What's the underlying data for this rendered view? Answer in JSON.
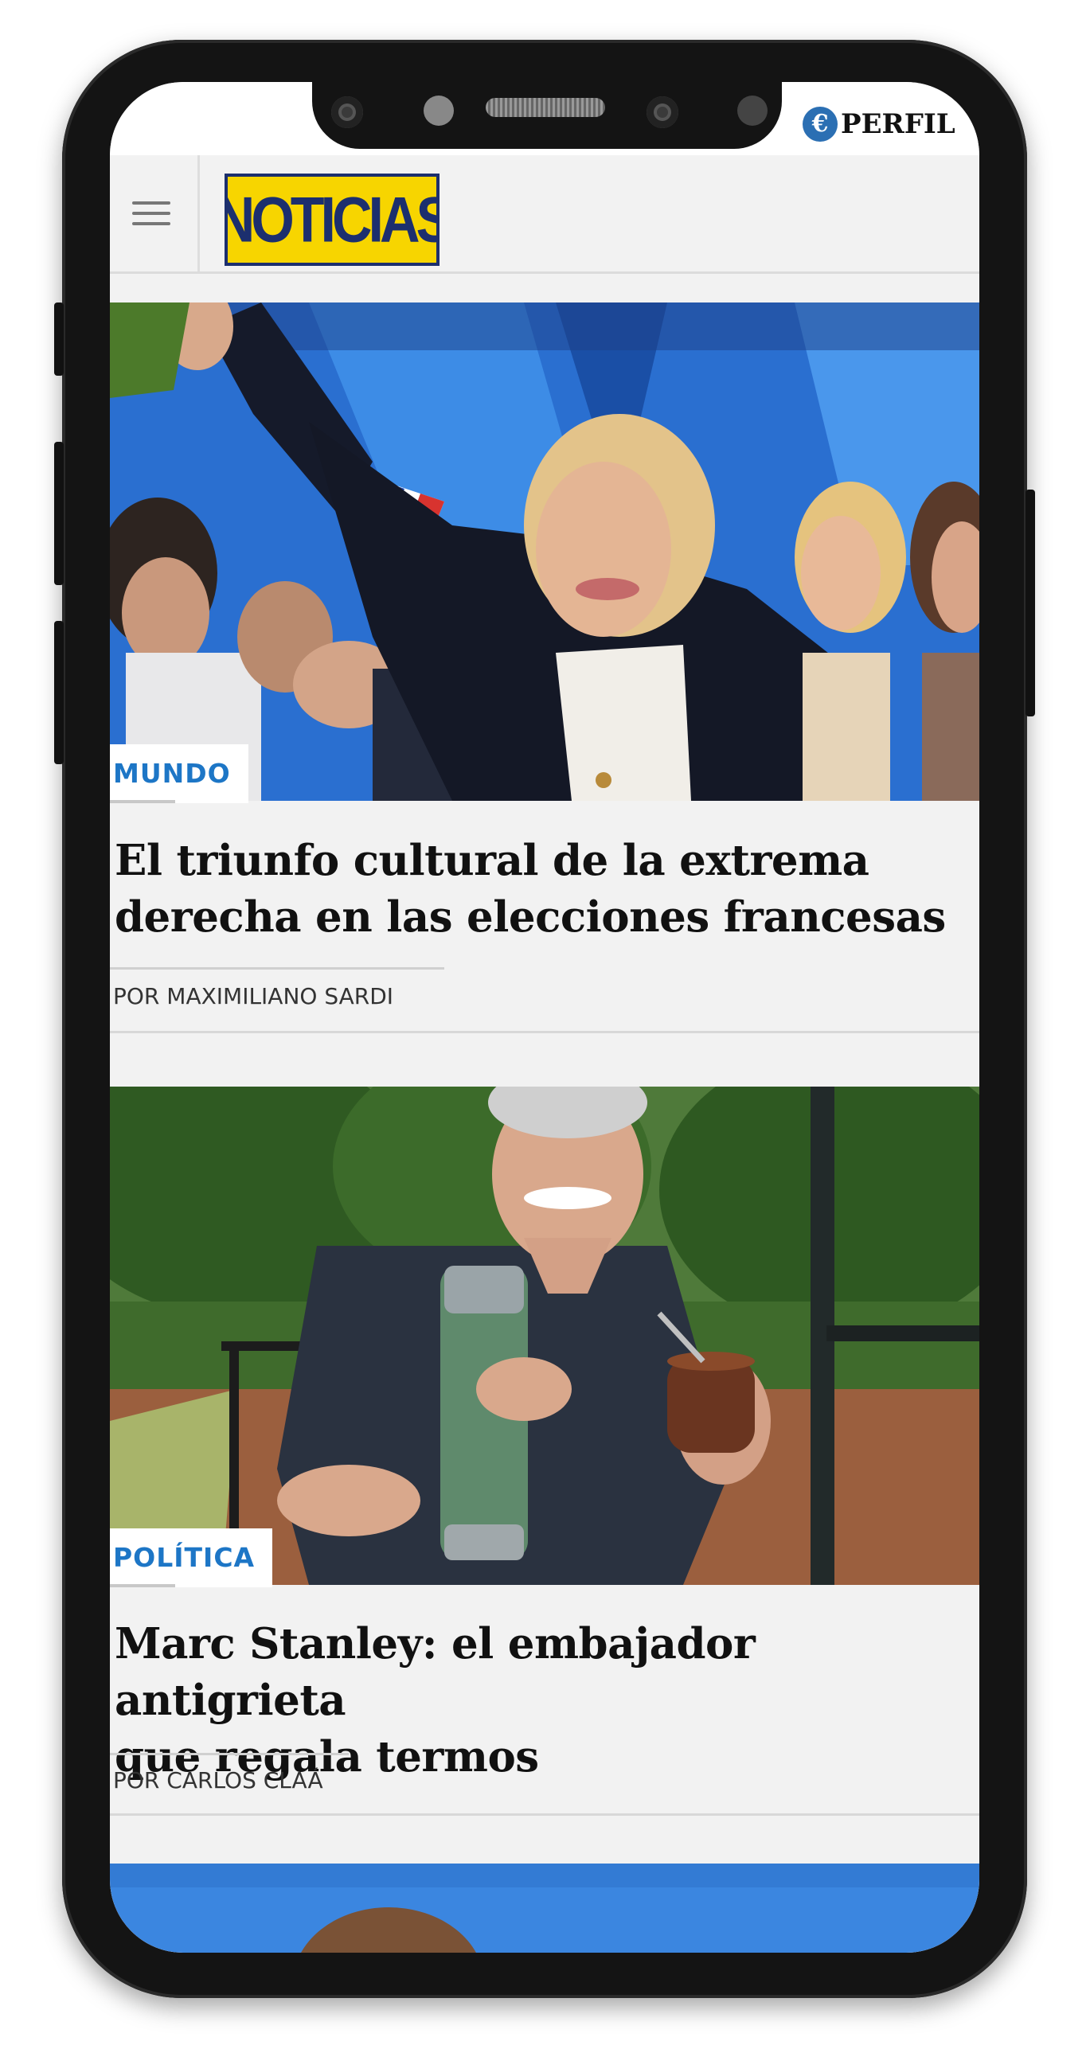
{
  "topbar": {
    "brand_icon": "€",
    "brand_name": "PERFIL"
  },
  "header": {
    "menu_icon": "hamburger-menu-icon",
    "logo_text": "NOTICIAS",
    "logo_colors": {
      "background": "#f7d500",
      "text": "#1c2f6e"
    }
  },
  "articles": [
    {
      "category": "MUNDO",
      "headline_lines": [
        "El triunfo cultural de la extrema",
        "derecha en las elecciones francesas"
      ],
      "byline": "POR MAXIMILIANO SARDI"
    },
    {
      "category": "POLÍTICA",
      "headline_lines": [
        "Marc Stanley: el embajador antigrieta",
        "que regala termos"
      ],
      "byline": "POR CARLOS CLAÁ"
    }
  ],
  "colors": {
    "category_text": "#1d76c6",
    "page_background": "#f2f2f2",
    "phone_frame": "#141414"
  }
}
